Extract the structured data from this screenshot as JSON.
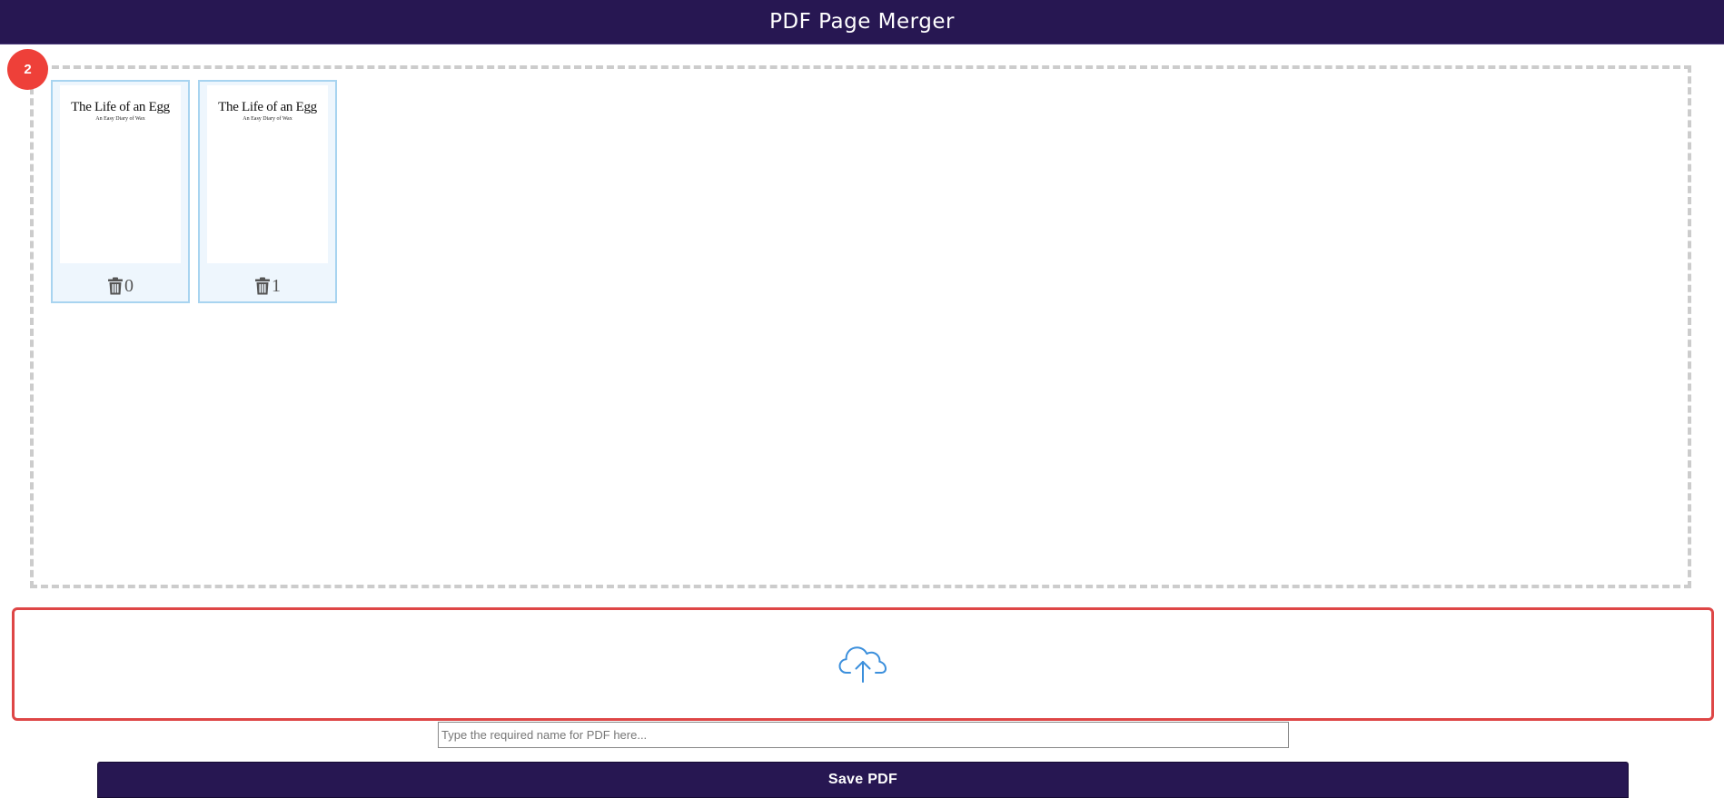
{
  "header": {
    "title": "PDF Page Merger"
  },
  "page_area": {
    "page_count": "2",
    "pages": [
      {
        "thumbnail_title": "The Life of an Egg",
        "thumbnail_subtitle": "An Easy Diary of Wax",
        "page_number": "0",
        "delete_icon": "trash-icon"
      },
      {
        "thumbnail_title": "The Life of an Egg",
        "thumbnail_subtitle": "An Easy Diary of Wax",
        "page_number": "1",
        "delete_icon": "trash-icon"
      }
    ]
  },
  "upload": {
    "icon": "cloud-upload-icon"
  },
  "filename": {
    "value": "",
    "placeholder": "Type the required name for PDF here..."
  },
  "actions": {
    "save_label": "Save PDF"
  },
  "colors": {
    "header_bg": "#271752",
    "badge_bg": "#ee4039",
    "upload_border": "#de4646",
    "card_border": "#a8d4f0",
    "cloud_icon": "#3b8fdc"
  }
}
